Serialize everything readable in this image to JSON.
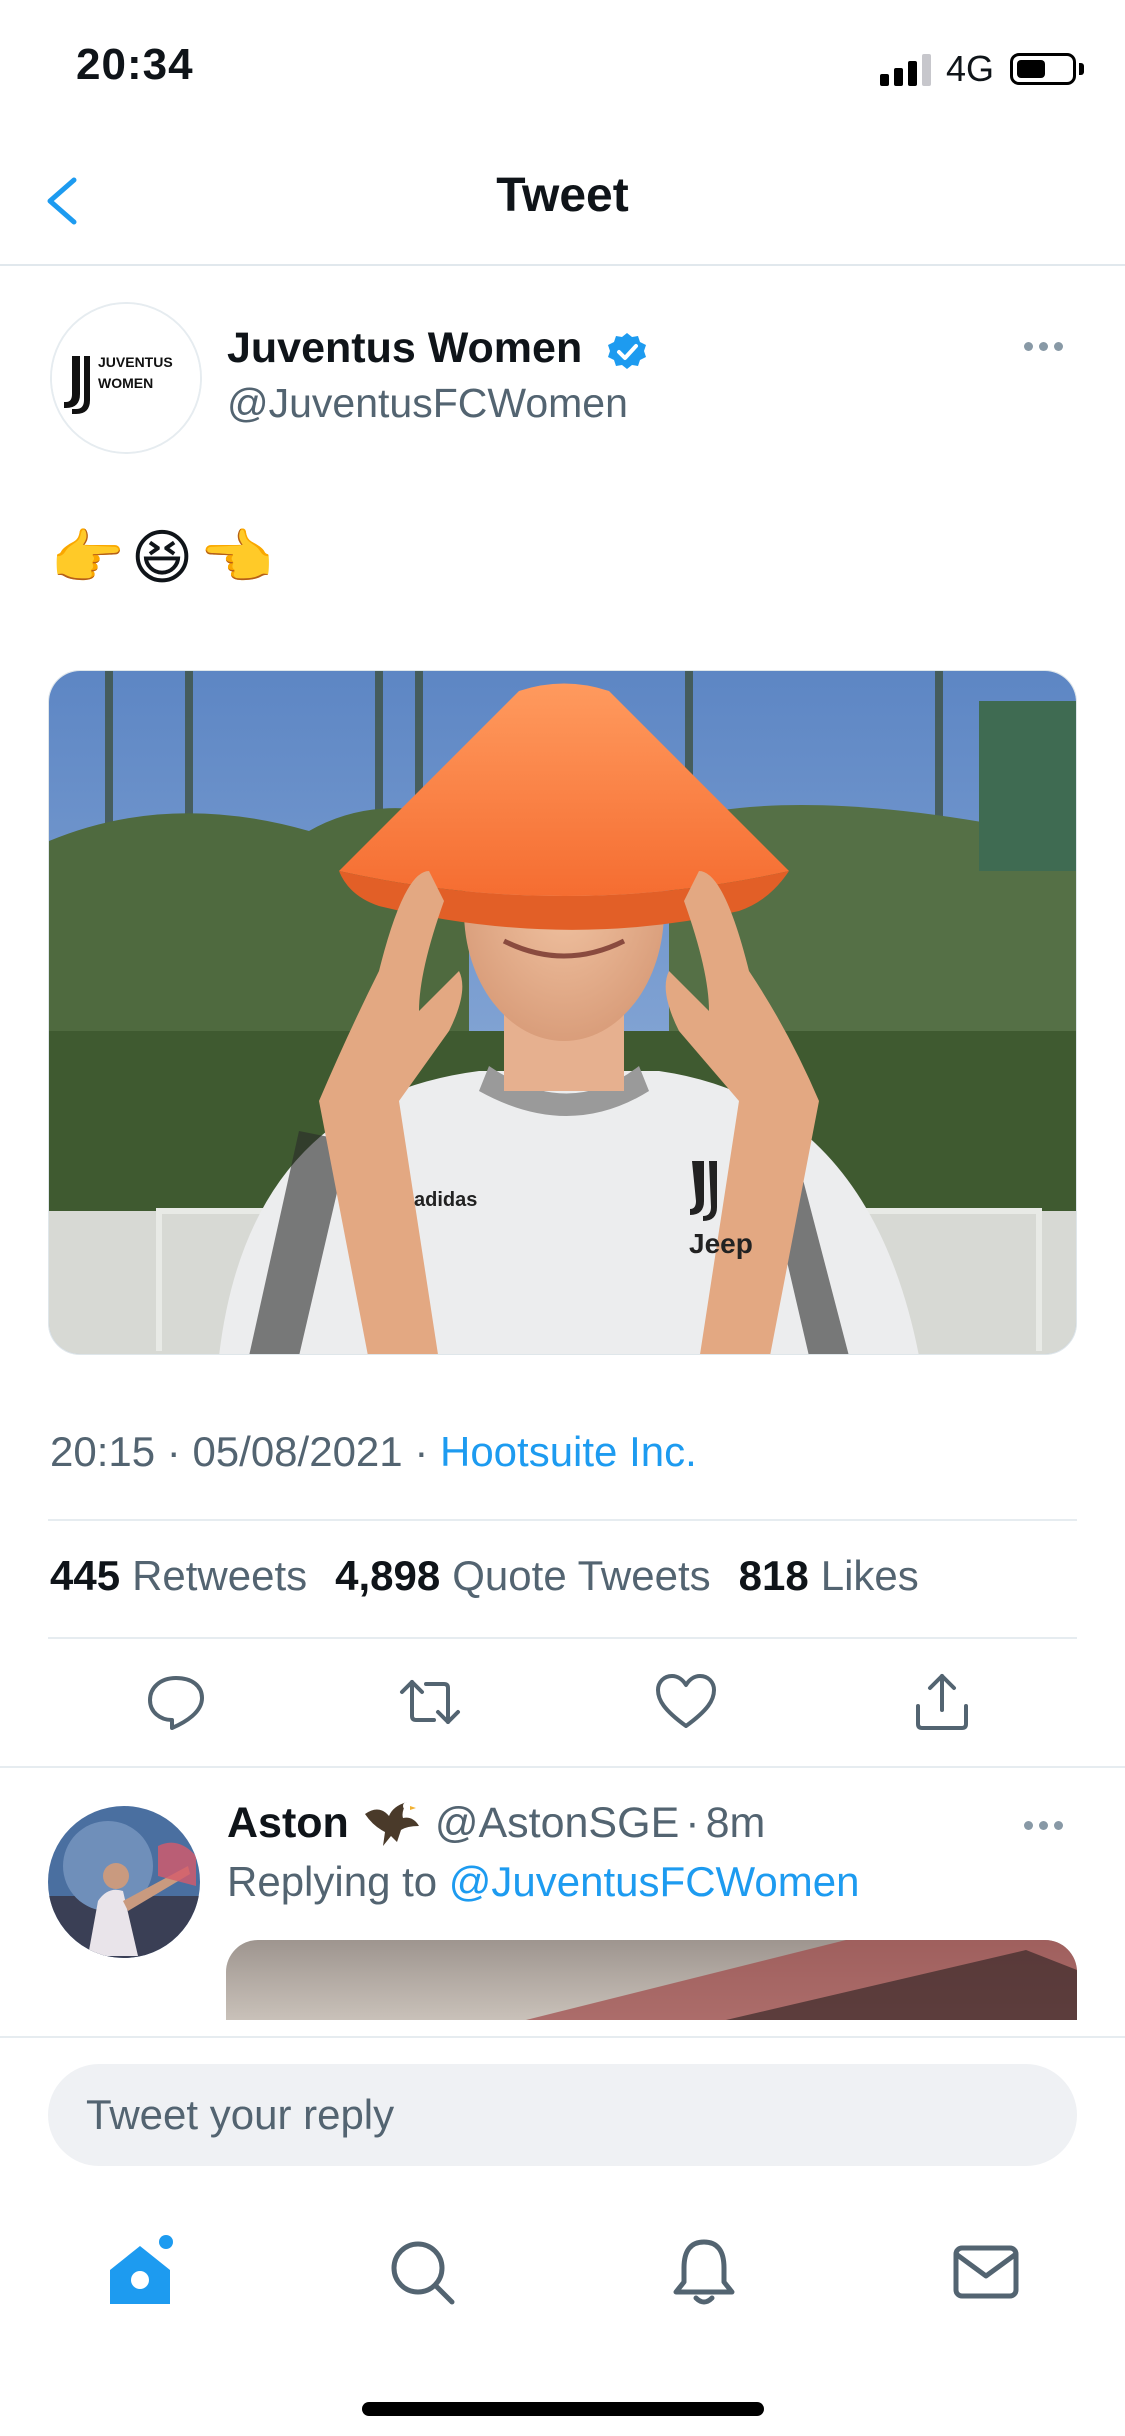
{
  "status_bar": {
    "time": "20:34",
    "network": "4G"
  },
  "header": {
    "title": "Tweet"
  },
  "tweet": {
    "author_name": "Juventus Women",
    "author_handle": "@JuventusFCWomen",
    "logo_text_line1": "JUVENTUS",
    "logo_text_line2": "WOMEN",
    "text": "👉😆👈",
    "time": "20:15",
    "date": "05/08/2021",
    "source": "Hootsuite Inc.",
    "media_jersey_text": "Jeep",
    "media_brand_text": "adidas",
    "stats": {
      "retweets_count": "445",
      "retweets_label": "Retweets",
      "quotes_count": "4,898",
      "quotes_label": "Quote Tweets",
      "likes_count": "818",
      "likes_label": "Likes"
    }
  },
  "reply": {
    "name": "Aston",
    "handle": "@AstonSGE",
    "separator": "·",
    "age": "8m",
    "replying_prefix": "Replying to",
    "replying_to": "@JuventusFCWomen"
  },
  "composer": {
    "placeholder": "Tweet your reply"
  },
  "colors": {
    "accent": "#1d9bf0",
    "secondary_text": "#536471",
    "divider": "#e6ecf0"
  },
  "icons": {
    "back": "chevron-left-icon",
    "verified": "verified-badge-icon",
    "more": "more-horizontal-icon",
    "actions": [
      "reply-icon",
      "retweet-icon",
      "like-icon",
      "share-icon"
    ],
    "tabs": [
      "home-icon",
      "search-icon",
      "notifications-icon",
      "messages-icon"
    ]
  }
}
